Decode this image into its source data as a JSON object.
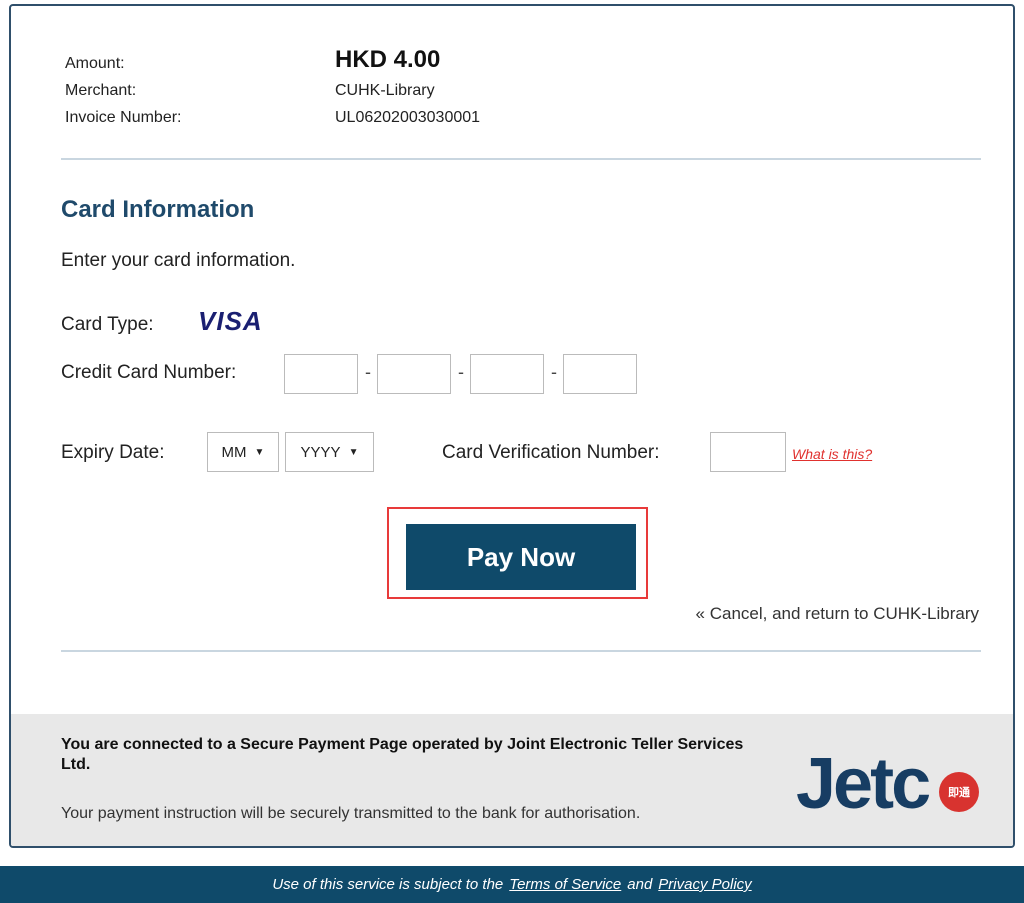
{
  "summary": {
    "amount_label": "Amount:",
    "amount_value": "HKD 4.00",
    "merchant_label": "Merchant:",
    "merchant_value": "CUHK-Library",
    "invoice_label": "Invoice Number:",
    "invoice_value": "UL06202003030001"
  },
  "card": {
    "title": "Card Information",
    "intro": "Enter your card information.",
    "type_label": "Card Type:",
    "type_value": "VISA",
    "number_label": "Credit Card Number:",
    "separator": "-",
    "expiry_label": "Expiry Date:",
    "month_selected": "MM",
    "year_selected": "YYYY",
    "cvn_label": "Card Verification Number:",
    "what_is_this": "What is this?"
  },
  "actions": {
    "pay_now": "Pay Now",
    "cancel": "« Cancel, and return to CUHK-Library"
  },
  "footer": {
    "secure_text": "You are connected to a Secure Payment Page operated by Joint Electronic Teller Services Ltd.",
    "transmit_text": "Your payment instruction will be securely transmitted to the bank for authorisation.",
    "logo_text": "Jetc",
    "logo_badge": "即通"
  },
  "bottom_bar": {
    "prefix": "Use of this service is subject to the",
    "terms": "Terms of Service",
    "and": "and",
    "privacy": "Privacy Policy"
  },
  "colors": {
    "accent": "#0f4a6a",
    "title": "#1f4a6b",
    "highlight_border": "#e83a3a",
    "link_red": "#e0312e"
  }
}
